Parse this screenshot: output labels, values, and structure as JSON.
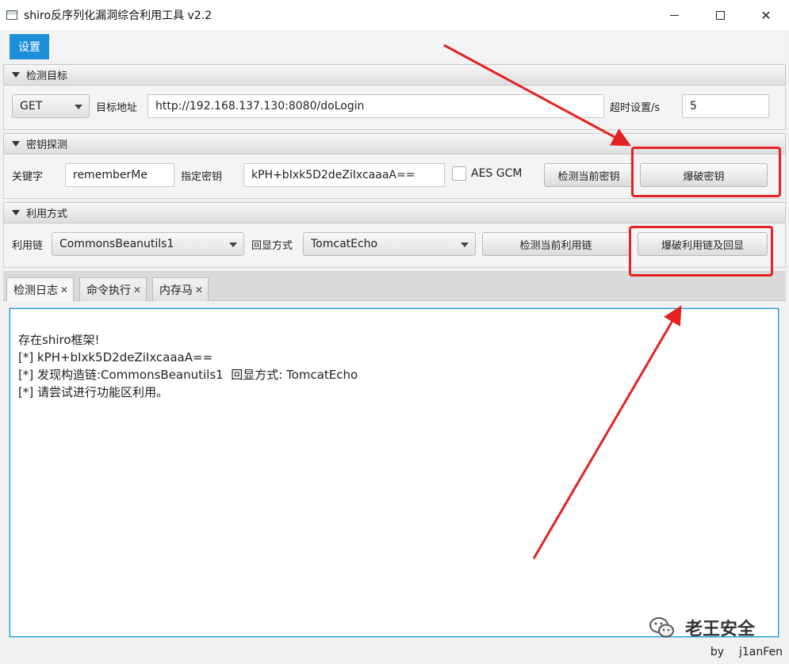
{
  "window": {
    "title": "shiro反序列化漏洞综合利用工具 v2.2",
    "controls": [
      "minimize",
      "maximize",
      "close"
    ]
  },
  "menu": {
    "settings_label": "设置"
  },
  "target": {
    "section_title": "检测目标",
    "method": "GET",
    "url_label": "目标地址",
    "url_value": "http://192.168.137.130:8080/doLogin",
    "timeout_label": "超时设置/s",
    "timeout_value": "5"
  },
  "key_detect": {
    "section_title": "密钥探测",
    "keyword_label": "关键字",
    "keyword_value": "rememberMe",
    "key_label": "指定密钥",
    "key_value": "kPH+bIxk5D2deZiIxcaaaA==",
    "aes_gcm_label": "AES GCM",
    "aes_gcm_checked": false,
    "check_key_button": "检测当前密钥",
    "brute_key_button": "爆破密钥"
  },
  "exploit": {
    "section_title": "利用方式",
    "chain_label": "利用链",
    "chain_value": "CommonsBeanutils1",
    "echo_label": "回显方式",
    "echo_value": "TomcatEcho",
    "check_chain_button": "检测当前利用链",
    "brute_chain_button": "爆破利用链及回显"
  },
  "tabs": [
    {
      "label": "检测日志",
      "active": true
    },
    {
      "label": "命令执行",
      "active": false
    },
    {
      "label": "内存马",
      "active": false
    }
  ],
  "log": {
    "lines": [
      "存在shiro框架!",
      "[*] kPH+bIxk5D2deZiIxcaaaA==",
      "[*] 发现构造链:CommonsBeanutils1  回显方式: TomcatEcho",
      "[*] 请尝试进行功能区利用。"
    ]
  },
  "watermark": "老王安全",
  "footer": {
    "by": "by",
    "author": "j1anFen"
  },
  "colors": {
    "accent": "#1d8fd8",
    "annotation": "#e52222"
  }
}
